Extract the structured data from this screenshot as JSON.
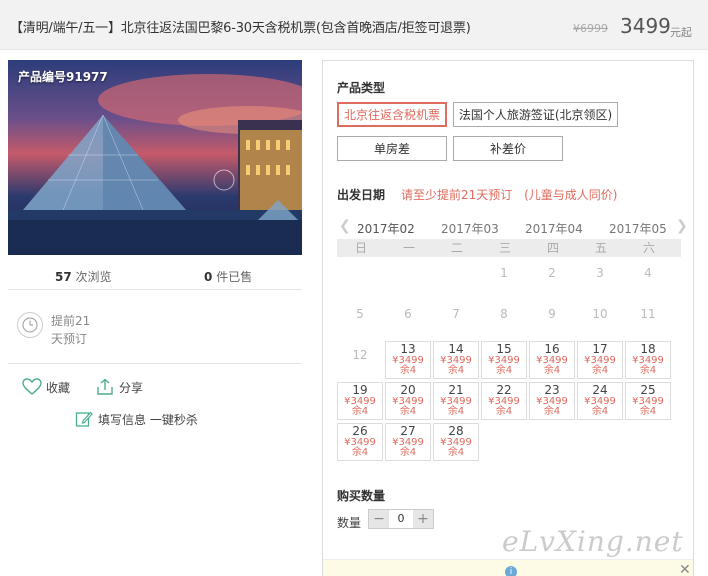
{
  "header": {
    "title": "【清明/端午/五一】北京往返法国巴黎6-30天含税机票(包含首晚酒店/拒签可退票)",
    "old_price": "¥6999",
    "price": "3499",
    "price_unit": "元起"
  },
  "product": {
    "code": "产品编号91977",
    "views_count": "57",
    "views_label": "次浏览",
    "sold_count": "0",
    "sold_label": "件已售",
    "booking_line1": "提前21",
    "booking_line2": "天预订",
    "favorite_label": "收藏",
    "share_label": "分享",
    "fill_info_label": "填写信息 一键秒杀"
  },
  "panel": {
    "product_type_label": "产品类型",
    "types": [
      {
        "label": "北京往返含税机票",
        "selected": true
      },
      {
        "label": "法国个人旅游签证(北京领区)",
        "selected": false
      },
      {
        "label": "单房差",
        "selected": false
      },
      {
        "label": "补差价",
        "selected": false
      }
    ],
    "date_label": "出发日期",
    "date_note1": "请至少提前21天预订",
    "date_note2": "(儿童与成人同价)",
    "months": [
      "2017年02",
      "2017年03",
      "2017年04",
      "2017年05"
    ],
    "weekdays": [
      "日",
      "一",
      "二",
      "三",
      "四",
      "五",
      "六"
    ],
    "calendar": {
      "inactive_days": [
        "1",
        "2",
        "3",
        "4",
        "5",
        "6",
        "7",
        "8",
        "9",
        "10",
        "11",
        "12"
      ],
      "available_days": [
        {
          "day": "13",
          "price": "¥3499",
          "stock": "余4"
        },
        {
          "day": "14",
          "price": "¥3499",
          "stock": "余4"
        },
        {
          "day": "15",
          "price": "¥3499",
          "stock": "余4"
        },
        {
          "day": "16",
          "price": "¥3499",
          "stock": "余4"
        },
        {
          "day": "17",
          "price": "¥3499",
          "stock": "余4"
        },
        {
          "day": "18",
          "price": "¥3499",
          "stock": "余4"
        },
        {
          "day": "19",
          "price": "¥3499",
          "stock": "余4"
        },
        {
          "day": "20",
          "price": "¥3499",
          "stock": "余4"
        },
        {
          "day": "21",
          "price": "¥3499",
          "stock": "余4"
        },
        {
          "day": "22",
          "price": "¥3499",
          "stock": "余4"
        },
        {
          "day": "23",
          "price": "¥3499",
          "stock": "余4"
        },
        {
          "day": "24",
          "price": "¥3499",
          "stock": "余4"
        },
        {
          "day": "25",
          "price": "¥3499",
          "stock": "余4"
        },
        {
          "day": "26",
          "price": "¥3499",
          "stock": "余4"
        },
        {
          "day": "27",
          "price": "¥3499",
          "stock": "余4"
        },
        {
          "day": "28",
          "price": "¥3499",
          "stock": "余4"
        }
      ]
    },
    "quantity_title": "购买数量",
    "quantity_label": "数量",
    "quantity_value": "0",
    "minus": "−",
    "plus": "+"
  },
  "watermark": "eLvXing.net",
  "colors": {
    "accent": "#e06b5f",
    "share_icon": "#4caf8a"
  }
}
